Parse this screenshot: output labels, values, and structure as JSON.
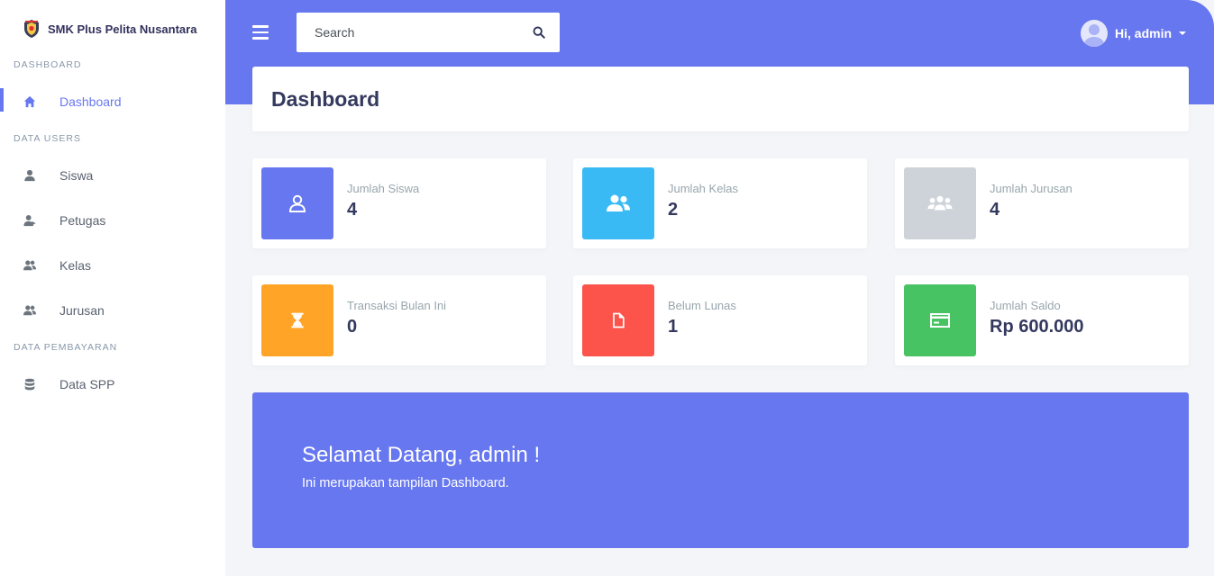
{
  "brand": {
    "name": "SMK Plus Pelita Nusantara",
    "logo_icon": "school-crest-icon"
  },
  "sidebar": {
    "sections": [
      {
        "label": "DASHBOARD",
        "items": [
          {
            "label": "Dashboard",
            "icon": "home-icon",
            "active": true
          }
        ]
      },
      {
        "label": "DATA USERS",
        "items": [
          {
            "label": "Siswa",
            "icon": "user-icon"
          },
          {
            "label": "Petugas",
            "icon": "user-tie-icon"
          },
          {
            "label": "Kelas",
            "icon": "users-icon"
          },
          {
            "label": "Jurusan",
            "icon": "users-icon"
          }
        ]
      },
      {
        "label": "DATA PEMBAYARAN",
        "items": [
          {
            "label": "Data SPP",
            "icon": "database-icon"
          }
        ]
      }
    ]
  },
  "header": {
    "search_placeholder": "Search",
    "user_greeting": "Hi, admin"
  },
  "page": {
    "title": "Dashboard"
  },
  "stats": [
    {
      "label": "Jumlah Siswa",
      "value": "4",
      "color": "#6777ef",
      "icon": "user-outline-icon"
    },
    {
      "label": "Jumlah Kelas",
      "value": "2",
      "color": "#3abaf4",
      "icon": "users-icon"
    },
    {
      "label": "Jumlah Jurusan",
      "value": "4",
      "color": "#cdd3d8",
      "icon": "users-group-icon"
    },
    {
      "label": "Transaksi Bulan Ini",
      "value": "0",
      "color": "#ffa426",
      "icon": "hourglass-icon"
    },
    {
      "label": "Belum Lunas",
      "value": "1",
      "color": "#fc544b",
      "icon": "file-icon"
    },
    {
      "label": "Jumlah Saldo",
      "value": "Rp 600.000",
      "color": "#47c363",
      "icon": "credit-card-icon"
    }
  ],
  "welcome": {
    "heading": "Selamat Datang, admin !",
    "text": "Ini merupakan tampilan Dashboard."
  }
}
